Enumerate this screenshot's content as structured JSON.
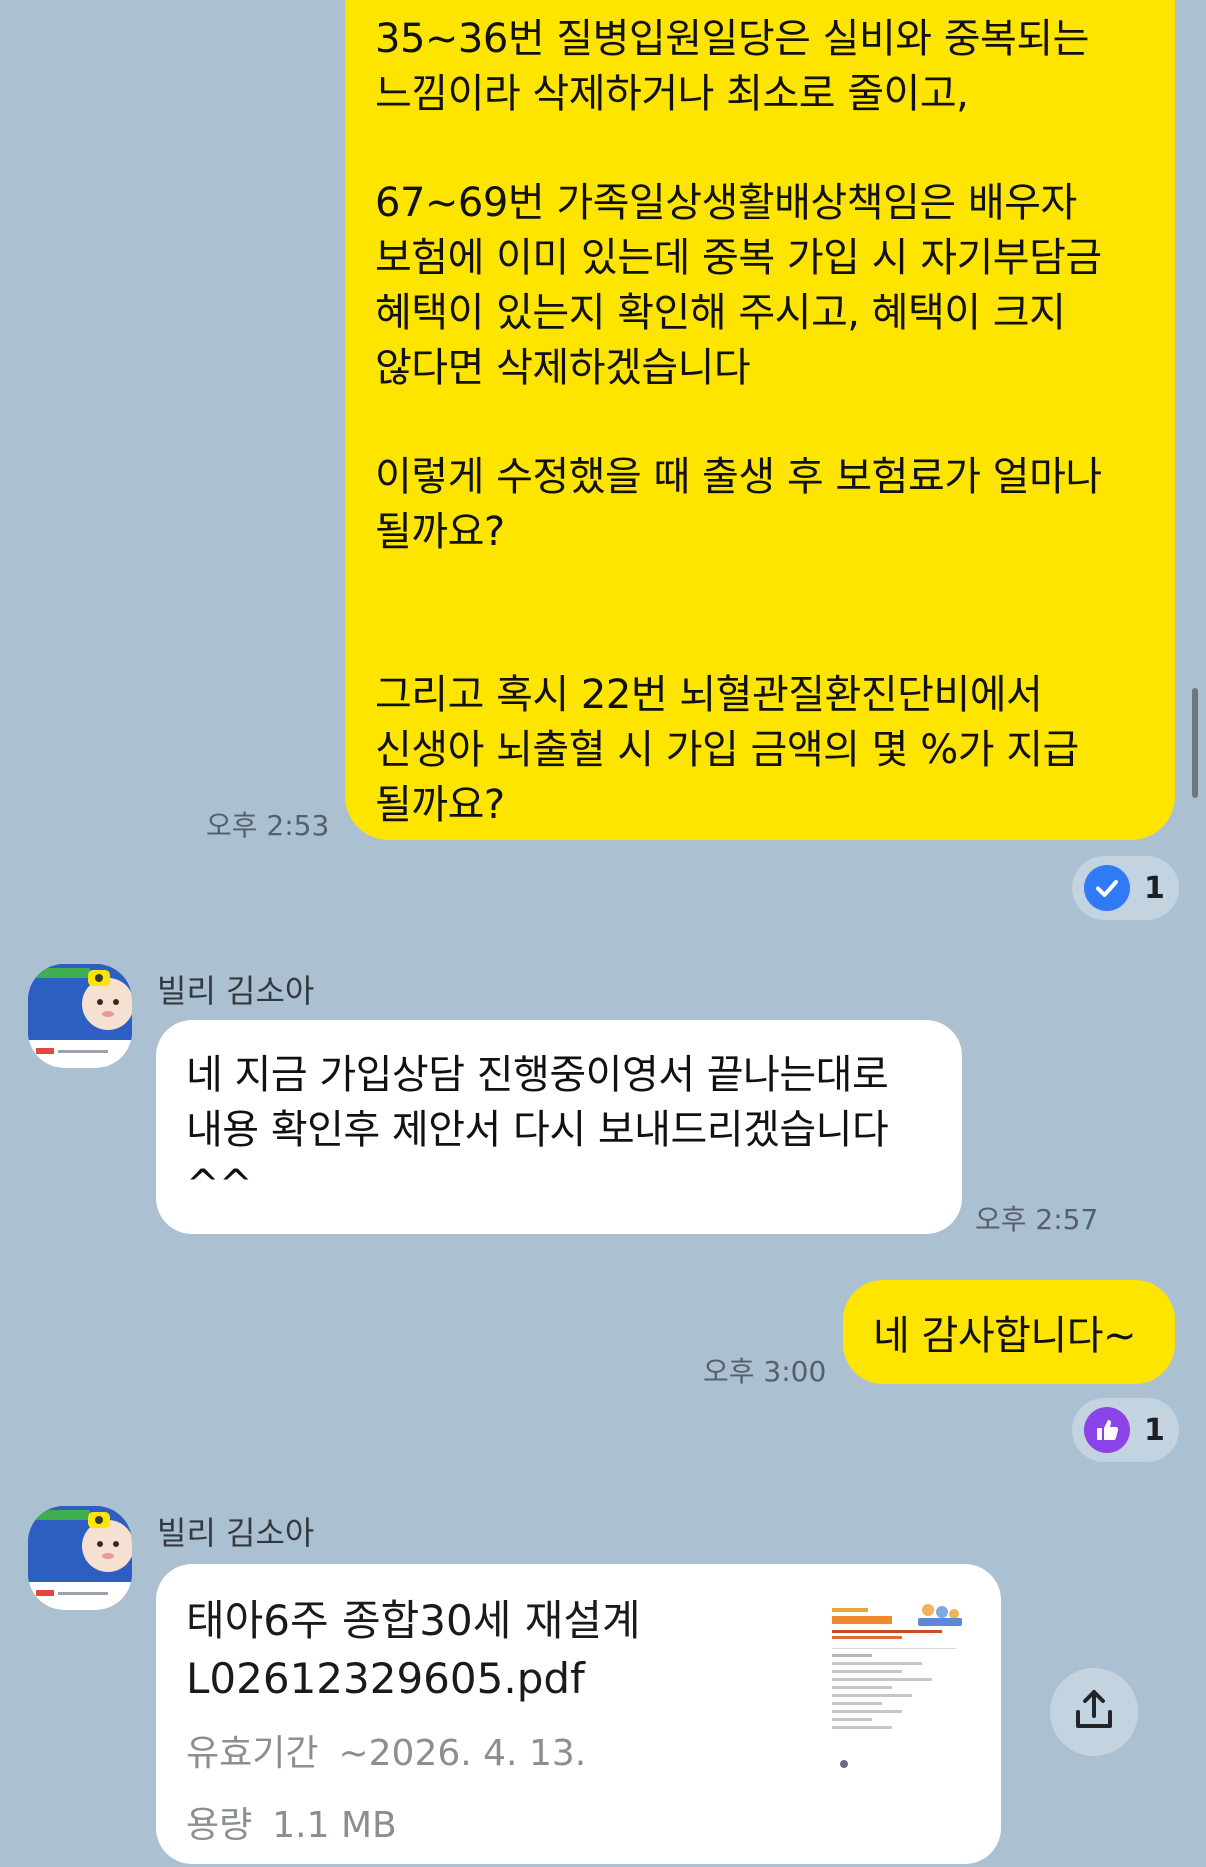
{
  "messages": {
    "out_long": {
      "para1": "35~36번 질병입원일당은 실비와 중복되는\n느낌이라 삭제하거나 최소로 줄이고,",
      "para2": "67~69번 가족일상생활배상책임은 배우자\n보험에 이미 있는데 중복 가입 시 자기부담금\n혜택이 있는지 확인해 주시고, 혜택이 크지\n않다면 삭제하겠습니다",
      "para3": "이렇게 수정했을 때 출생 후 보험료가 얼마나\n될까요?",
      "para4": "그리고 혹시 22번 뇌혈관질환진단비에서\n신생아 뇌출혈 시 가입 금액의 몇 %가 지급\n될까요?",
      "time": "오후 2:53",
      "reaction": {
        "icon": "check-icon",
        "count": "1",
        "color": "#2f7bf5"
      }
    },
    "in_reply": {
      "sender": "빌리 김소아",
      "text": "네 지금 가입상담 진행중이영서 끝나는대로\n내용 확인후 제안서 다시 보내드리겠습니다\n^^",
      "time": "오후 2:57"
    },
    "out_thanks": {
      "text": "네 감사합니다~",
      "time": "오후 3:00",
      "reaction": {
        "icon": "thumbs-up-icon",
        "count": "1",
        "color": "#8a43e6"
      }
    },
    "in_file": {
      "sender": "빌리 김소아",
      "title": "태아6주 종합30세 재설계\nL02612329605.pdf",
      "validity_label": "유효기간",
      "validity_value": "~2026. 4. 13.",
      "size_label": "용량",
      "size_value": "1.1 MB"
    }
  },
  "colors": {
    "background": "#abc1d1",
    "outgoing_bubble": "#fee500",
    "incoming_bubble": "#ffffff",
    "time_text": "#56606a"
  }
}
